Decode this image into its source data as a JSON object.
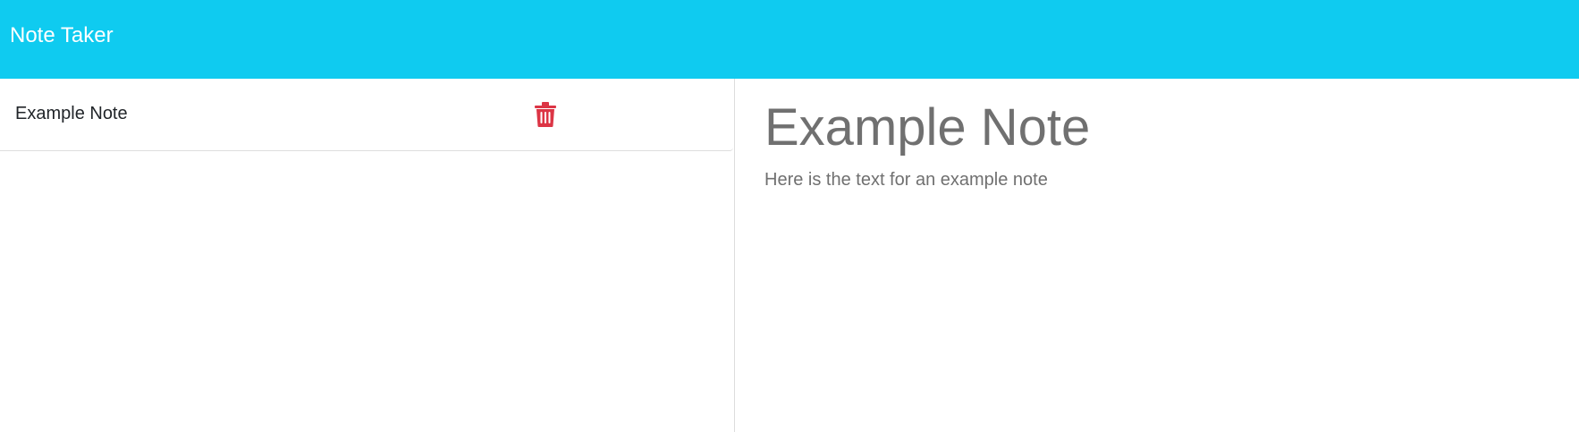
{
  "app": {
    "title": "Note Taker",
    "accent_color": "#0fcbf0",
    "danger_color": "#dc3545"
  },
  "sidebar": {
    "notes": [
      {
        "title": "Example Note",
        "action_icon": "trash-icon"
      }
    ]
  },
  "editor": {
    "note_title": "Example Note",
    "note_text": "Here is the text for an example note"
  }
}
